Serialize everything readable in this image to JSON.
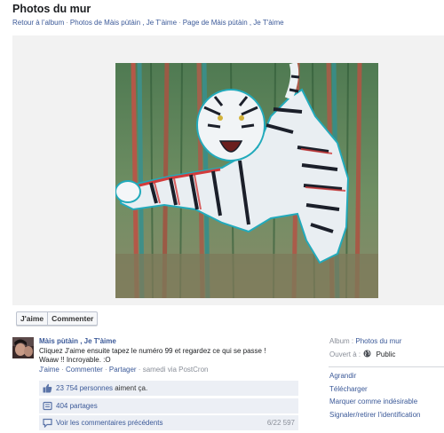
{
  "title": "Photos du mur",
  "breadcrumbs": [
    "Retour à l’album",
    "Photos de Màis pùtàin , Je T'àime",
    "Page de Màis pùtàin , Je T'àime"
  ],
  "buttons": {
    "like": "J'aime",
    "comment": "Commenter"
  },
  "post": {
    "author": "Màis pùtàin , Je T'àime",
    "line1": "Cliquez J'aime ensuite tapez le numéro 99 et regardez ce qui se passe !",
    "line2": "Waaw !! Incroyable. :O",
    "like": "J'aime",
    "comment": "Commenter",
    "share": "Partager",
    "time": "samedi via PostCron"
  },
  "stats": {
    "likes_link": "23 754 personnes",
    "likes_suffix": " aiment ça.",
    "shares": "404 partages",
    "previous_comments": "Voir les commentaires précédents",
    "comment_count": "6/22 597"
  },
  "sidebar": {
    "album_label": "Album :",
    "album_value": "Photos du mur",
    "open_label": "Ouvert à :",
    "open_value": "Public",
    "links": [
      "Agrandir",
      "Télécharger",
      "Marquer comme indésirable",
      "Signaler/retirer l'identification"
    ]
  }
}
